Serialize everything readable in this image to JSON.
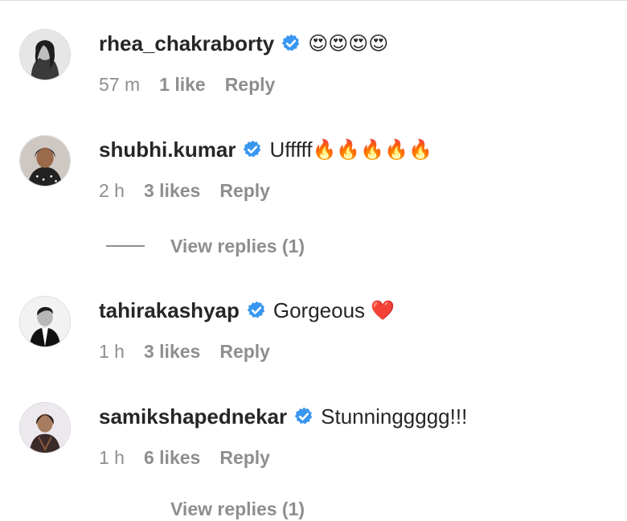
{
  "comments": [
    {
      "username": "rhea_chakraborty",
      "verified": true,
      "text": "",
      "emoji": "😍😍😍😍",
      "time": "57 m",
      "likes": "1 like",
      "reply": "Reply",
      "avatar_icon": "profile-photo"
    },
    {
      "username": "shubhi.kumar",
      "verified": true,
      "text": "Ufffff",
      "emoji": "🔥🔥🔥🔥🔥",
      "time": "2 h",
      "likes": "3 likes",
      "reply": "Reply",
      "avatar_icon": "profile-photo"
    },
    {
      "username": "tahirakashyap",
      "verified": true,
      "text": "Gorgeous ",
      "emoji": "❤️",
      "time": "1 h",
      "likes": "3 likes",
      "reply": "Reply",
      "avatar_icon": "profile-photo"
    },
    {
      "username": "samikshapednekar",
      "verified": true,
      "text": "Stunninggggg!!!",
      "emoji": "",
      "time": "1 h",
      "likes": "6 likes",
      "reply": "Reply",
      "avatar_icon": "profile-photo"
    }
  ],
  "view_replies": [
    {
      "label": "View replies (1)"
    },
    {
      "label": "View replies (1)"
    }
  ],
  "colors": {
    "text": "#262626",
    "muted": "#8e8e8e",
    "verified_badge": "#3897f0",
    "divider": "#dbdbdb"
  }
}
